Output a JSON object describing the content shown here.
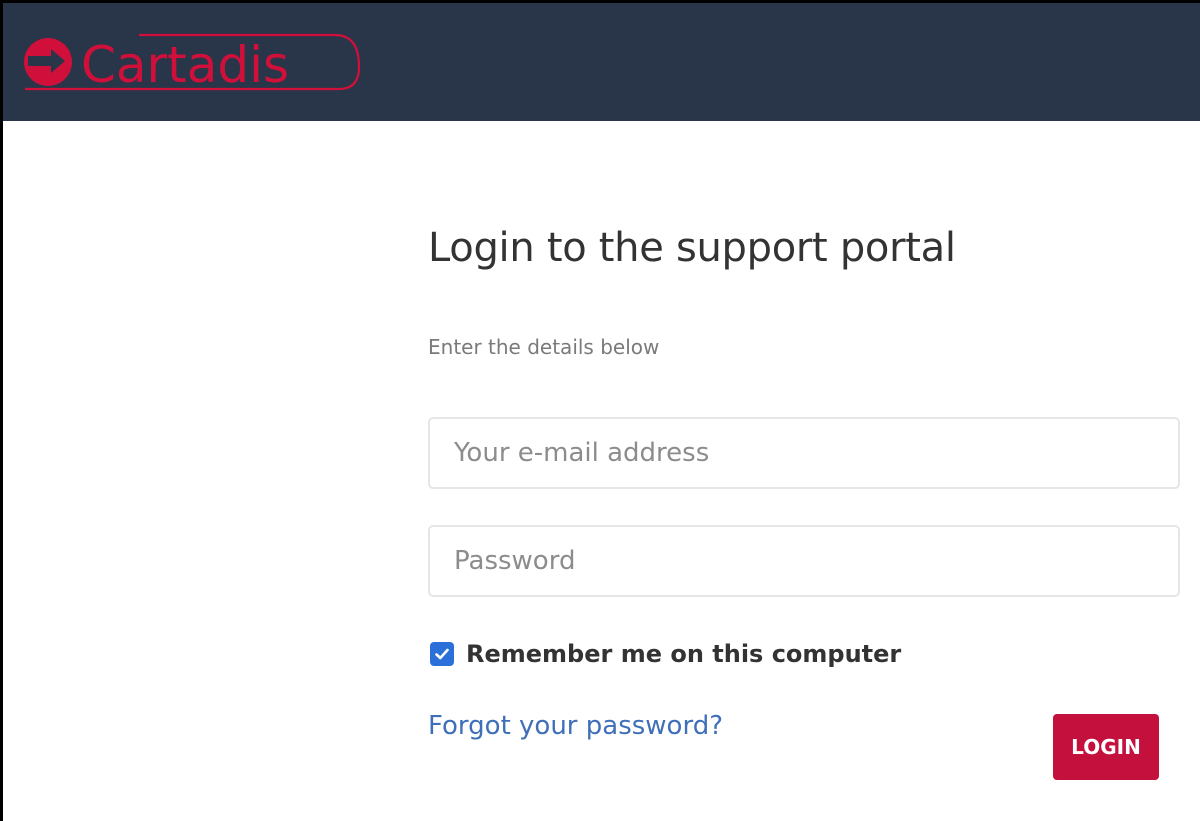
{
  "header": {
    "brand": "Cartadis",
    "colors": {
      "background": "#293548",
      "brand_red": "#d0103a"
    }
  },
  "login": {
    "title": "Login to the support portal",
    "subtitle": "Enter the details below",
    "email_placeholder": "Your e-mail address",
    "password_placeholder": "Password",
    "remember_label": "Remember me on this computer",
    "remember_checked": true,
    "forgot_link": "Forgot your password?",
    "login_button": "LOGIN",
    "colors": {
      "button": "#c4103c",
      "link": "#3f6fb8",
      "checkbox": "#2b6fd8"
    }
  }
}
